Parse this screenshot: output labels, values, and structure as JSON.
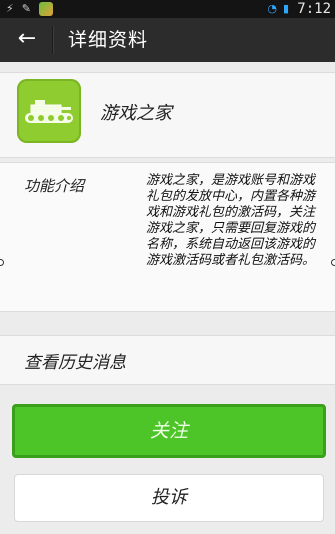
{
  "status_bar": {
    "left_icons": [
      "usb-icon",
      "wrench-icon",
      "app-icon"
    ],
    "right_icons": [
      "wifi-icon",
      "signal-icon"
    ],
    "time": "7:12"
  },
  "header": {
    "back_icon": "←",
    "title": "详细资料"
  },
  "profile": {
    "name": "游戏之家"
  },
  "intro": {
    "label": "功能介绍",
    "text": "游戏之家，是游戏账号和游戏礼包的发放中心，内置各种游戏和游戏礼包的激活码，关注游戏之家，只需要回复游戏的名称，系统自动返回该游戏的游戏激活码或者礼包激活码。"
  },
  "history": {
    "label": "查看历史消息"
  },
  "buttons": {
    "follow": "关注",
    "report": "投诉"
  },
  "colors": {
    "accent": "#4dc428",
    "header_bg": "#2c2c2c"
  }
}
